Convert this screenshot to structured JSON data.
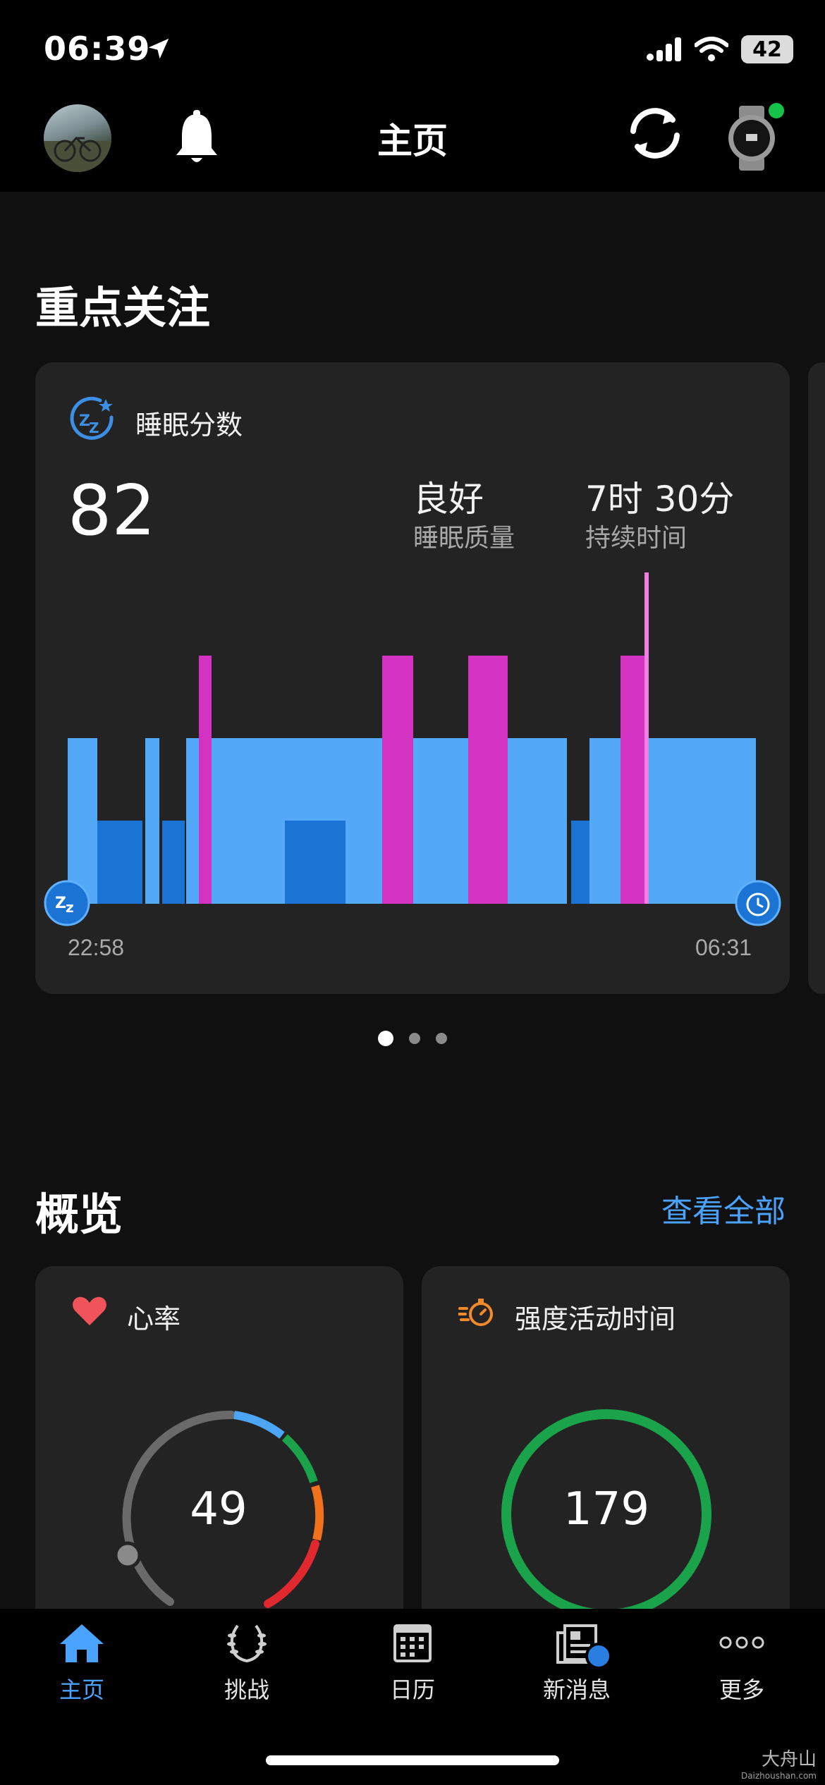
{
  "status_bar": {
    "time": "06:39",
    "battery": "42"
  },
  "header": {
    "title": "主页"
  },
  "focus": {
    "heading": "重点关注"
  },
  "sleep_card": {
    "title": "睡眠分数",
    "score": "82",
    "quality_value": "良好",
    "quality_label": "睡眠质量",
    "duration_value": "7时 30分",
    "duration_label": "持续时间",
    "start_time": "22:58",
    "end_time": "06:31",
    "colors": {
      "light": "#54a8f8",
      "deep": "#1b74d4",
      "rem": "#d332c3",
      "awake": "#ef7fe0"
    }
  },
  "pager": {
    "count": 3,
    "active": 0
  },
  "overview": {
    "heading": "概览",
    "view_all": "查看全部"
  },
  "heart_rate_card": {
    "title": "心率",
    "value": "49"
  },
  "intensity_card": {
    "title": "强度活动时间",
    "value": "179"
  },
  "tabs": [
    {
      "label": "主页",
      "icon": "home-icon",
      "active": true
    },
    {
      "label": "挑战",
      "icon": "laurel-icon"
    },
    {
      "label": "日历",
      "icon": "calendar-icon"
    },
    {
      "label": "新消息",
      "icon": "news-icon",
      "badge": true
    },
    {
      "label": "更多",
      "icon": "more-icon"
    }
  ],
  "watermark": {
    "text": "大舟山",
    "sub": "Daizhoushan.com"
  }
}
